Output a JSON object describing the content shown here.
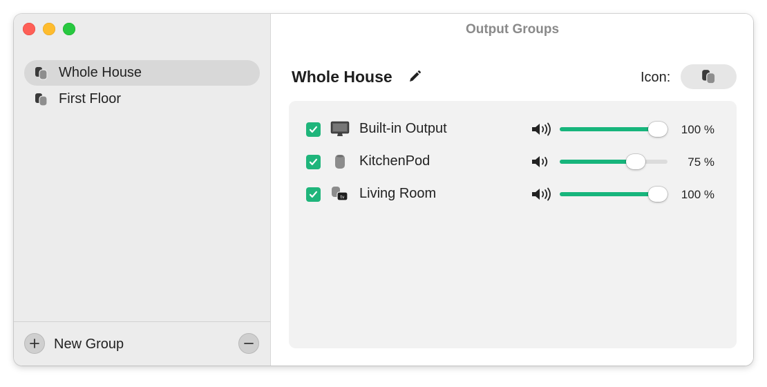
{
  "window": {
    "title": "Output Groups"
  },
  "sidebar": {
    "groups": [
      {
        "label": "Whole House",
        "icon": "homepod-group-icon",
        "selected": true
      },
      {
        "label": "First Floor",
        "icon": "homepod-group-icon",
        "selected": false
      }
    ],
    "new_group_label": "New Group"
  },
  "detail": {
    "group_name": "Whole House",
    "icon_label": "Icon:",
    "selected_icon": "homepod-group-icon",
    "outputs": [
      {
        "name": "Built-in Output",
        "icon": "monitor-icon",
        "checked": true,
        "volume": 100,
        "volume_label": "100 %"
      },
      {
        "name": "KitchenPod",
        "icon": "homepod-icon",
        "checked": true,
        "volume": 75,
        "volume_label": "75 %"
      },
      {
        "name": "Living Room",
        "icon": "homepod-appletv-icon",
        "checked": true,
        "volume": 100,
        "volume_label": "100 %"
      }
    ]
  },
  "colors": {
    "accent": "#17b57c",
    "checkbox": "#1fb57b",
    "traffic_close": "#fe5f57",
    "traffic_minimize": "#febc2e",
    "traffic_maximize": "#28c840"
  }
}
